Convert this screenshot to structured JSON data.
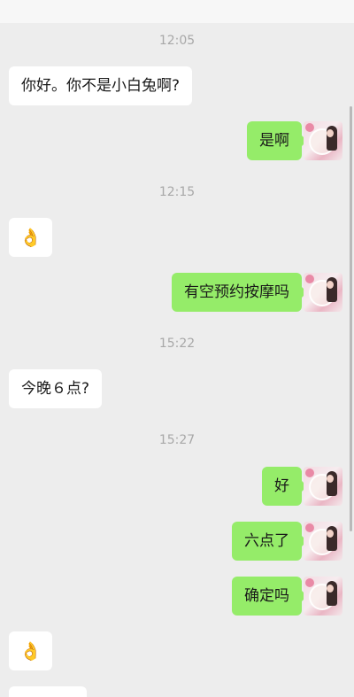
{
  "messages": [
    {
      "kind": "time",
      "text": "12:05"
    },
    {
      "kind": "incoming",
      "text": "你好。你不是小白兔啊?"
    },
    {
      "kind": "outgoing",
      "text": "是啊"
    },
    {
      "kind": "time",
      "text": "12:15"
    },
    {
      "kind": "incoming",
      "text": "👌"
    },
    {
      "kind": "outgoing",
      "text": "有空预约按摩吗"
    },
    {
      "kind": "time",
      "text": "15:22"
    },
    {
      "kind": "incoming",
      "text": "今晚６点?"
    },
    {
      "kind": "time",
      "text": "15:27"
    },
    {
      "kind": "outgoing",
      "text": "好"
    },
    {
      "kind": "outgoing",
      "text": "六点了"
    },
    {
      "kind": "outgoing",
      "text": "确定吗"
    },
    {
      "kind": "incoming",
      "text": "👌"
    }
  ],
  "colors": {
    "background": "#ededed",
    "incoming_bubble": "#ffffff",
    "outgoing_bubble": "#95ec69",
    "time_text": "#a8a8a8"
  },
  "icons": {
    "avatar": "self-avatar-photo",
    "emoji": "ok-hand-emoji"
  }
}
